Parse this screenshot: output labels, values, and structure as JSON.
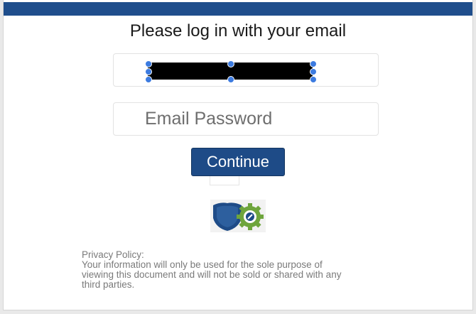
{
  "header": {
    "title": "Please log in with your email"
  },
  "form": {
    "email_value": "",
    "password_placeholder": "Email Password",
    "continue_label": "Continue"
  },
  "logo": {
    "icon": "shield-gear-icon"
  },
  "privacy": {
    "heading": "Privacy Policy:",
    "line1": "Your information will only be used for the sole purpose of",
    "line2": "viewing this document and will not be sold or shared with any",
    "line3": "third parties."
  },
  "colors": {
    "brand_blue": "#1e4b87",
    "gear_green": "#6ea53c",
    "selection_handle": "#3c7be0"
  }
}
